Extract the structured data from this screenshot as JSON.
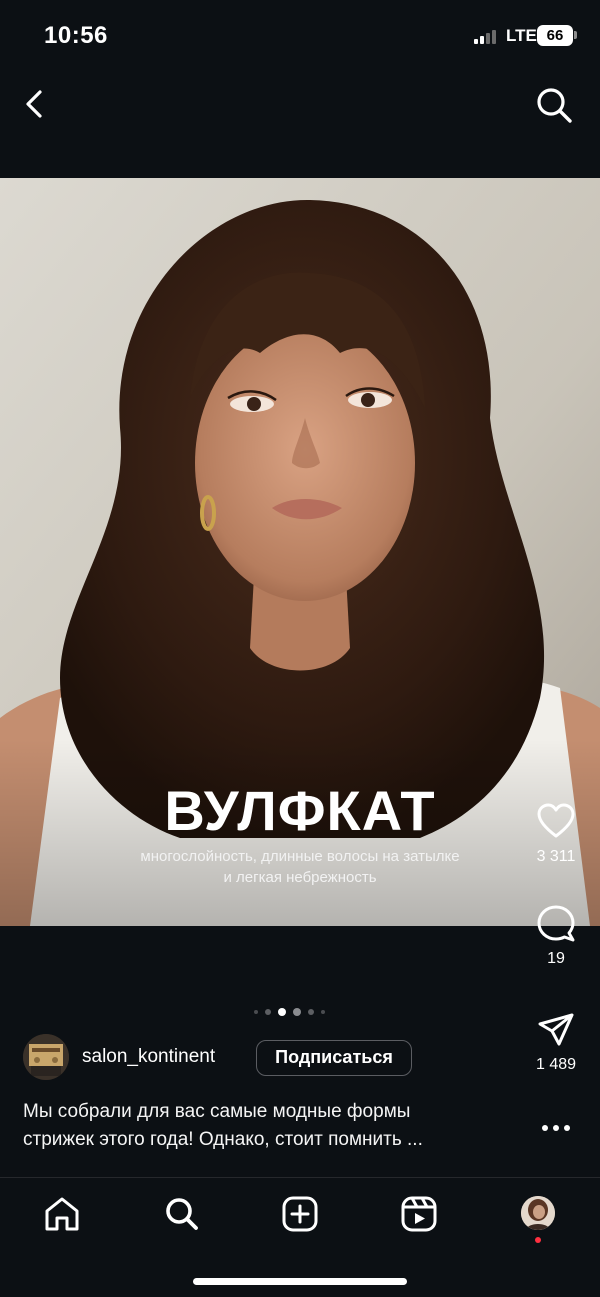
{
  "status_bar": {
    "time": "10:56",
    "network": "LTE",
    "battery": "66"
  },
  "post": {
    "overlay_title": "ВУЛФКАТ",
    "overlay_subtitle_line1": "многослойность, длинные волосы на затылке",
    "overlay_subtitle_line2": "и легкая небрежность",
    "likes": "3 311",
    "comments": "19",
    "shares": "1 489",
    "carousel": {
      "count": 6,
      "active_index": 2
    },
    "account": {
      "username": "salon_kontinent",
      "follow_label": "Подписаться"
    },
    "caption_line1": "Мы собрали для вас самые модные формы",
    "caption_line2": "стрижек этого года! Однако, стоит помнить ..."
  },
  "icons": {
    "back": "chevron-left-icon",
    "search": "search-icon",
    "like": "heart-icon",
    "comment": "comment-icon",
    "share": "send-icon",
    "more": "more-icon",
    "home": "home-icon",
    "explore": "search-icon",
    "create": "plus-square-icon",
    "reels": "reels-icon",
    "profile": "profile-avatar"
  },
  "colors": {
    "background": "#0c1014",
    "notification": "#ff3040",
    "follow_border": "#5b5d62"
  }
}
